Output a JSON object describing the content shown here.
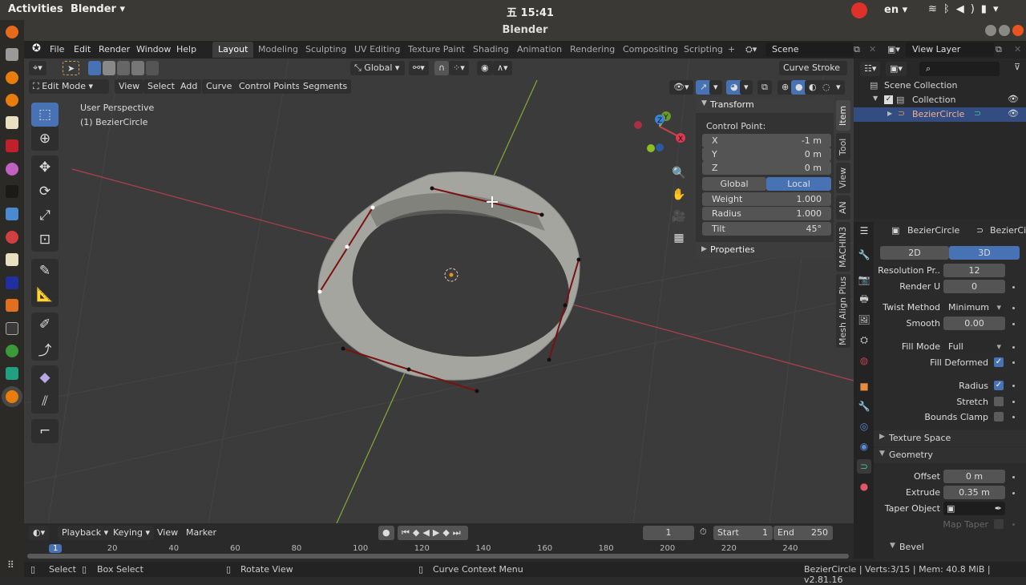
{
  "os_bar": {
    "activities": "Activities",
    "app_menu": "Blender ▾",
    "clock": "五 15:41",
    "language": "en ▾",
    "system_icons": [
      "wifi-icon",
      "bluetooth-icon",
      "volume-icon",
      "battery-icon",
      "dropdown-icon"
    ]
  },
  "window": {
    "title": "Blender"
  },
  "menu": {
    "items": [
      "File",
      "Edit",
      "Render",
      "Window",
      "Help"
    ],
    "workspaces": [
      "Layout",
      "Modeling",
      "Sculpting",
      "UV Editing",
      "Texture Paint",
      "Shading",
      "Animation",
      "Rendering",
      "Compositing",
      "Scripting"
    ],
    "active_workspace": "Layout",
    "add_workspace": "+",
    "scene": "Scene",
    "view_layer": "View Layer"
  },
  "viewport": {
    "orientation": "Global",
    "curve_stroke": "Curve Stroke",
    "mode": "Edit Mode",
    "header_menus": [
      "View",
      "Select",
      "Add",
      "Curve",
      "Control Points",
      "Segments"
    ],
    "overlay_line1": "User Perspective",
    "overlay_line2": "(1) BezierCircle",
    "gizmo_axes": {
      "x": "X",
      "y": "Y",
      "z": "Z"
    }
  },
  "npanel": {
    "section": "Transform",
    "subtitle": "Control Point:",
    "fields": [
      {
        "label": "X",
        "value": "-1 m"
      },
      {
        "label": "Y",
        "value": "0 m"
      },
      {
        "label": "Z",
        "value": "0 m"
      }
    ],
    "space_toggle": {
      "options": [
        "Global",
        "Local"
      ],
      "selected": "Local"
    },
    "extra_fields": [
      {
        "label": "Weight",
        "value": "1.000"
      },
      {
        "label": "Radius",
        "value": "1.000"
      },
      {
        "label": "Tilt",
        "value": "45°"
      }
    ],
    "properties_section": "Properties",
    "tabs": [
      "Item",
      "Tool",
      "View",
      "AN",
      "MACHIN3",
      "Mesh Align Plus"
    ],
    "active_tab": "Item"
  },
  "outliner": {
    "search_placeholder": "",
    "items": [
      {
        "label": "Scene Collection",
        "level": 0
      },
      {
        "label": "Collection",
        "level": 1
      },
      {
        "label": "BezierCircle",
        "level": 2,
        "selected": true
      }
    ]
  },
  "properties": {
    "object_name": "BezierCircle",
    "data_name": "BezierCi",
    "dimension_toggle": {
      "options": [
        "2D",
        "3D"
      ],
      "selected": "3D"
    },
    "resolution_preview_label": "Resolution Pr..",
    "resolution_preview": "12",
    "render_u_label": "Render U",
    "render_u": "0",
    "twist_method_label": "Twist Method",
    "twist_method": "Minimum",
    "smooth_label": "Smooth",
    "smooth": "0.00",
    "fill_mode_label": "Fill Mode",
    "fill_mode": "Full",
    "fill_deformed_label": "Fill Deformed",
    "fill_deformed": true,
    "radius_label": "Radius",
    "radius": true,
    "stretch_label": "Stretch",
    "stretch": false,
    "bounds_clamp_label": "Bounds Clamp",
    "bounds_clamp": false,
    "texture_space_section": "Texture Space",
    "geometry_section": "Geometry",
    "offset_label": "Offset",
    "offset": "0 m",
    "extrude_label": "Extrude",
    "extrude": "0.35 m",
    "taper_object_label": "Taper Object",
    "map_taper_label": "Map Taper",
    "map_taper": false,
    "bevel_section": "Bevel"
  },
  "timeline": {
    "menus": [
      "Playback",
      "Keying",
      "View",
      "Marker"
    ],
    "current_frame": "1",
    "start_label": "Start",
    "start": "1",
    "end_label": "End",
    "end": "250",
    "ruler_ticks": [
      "1",
      "20",
      "40",
      "60",
      "80",
      "100",
      "120",
      "140",
      "160",
      "180",
      "200",
      "220",
      "240"
    ]
  },
  "statusbar": {
    "select": "Select",
    "box_select": "Box Select",
    "rotate_view": "Rotate View",
    "context_menu": "Curve Context Menu",
    "info": "BezierCircle | Verts:3/15 | Mem: 40.8 MiB | v2.81.16"
  },
  "colors": {
    "accent": "#4772b3",
    "x_axis": "#d0404a",
    "y_axis": "#8ab838",
    "z_axis": "#3c82d8",
    "record": "#e0302a"
  }
}
